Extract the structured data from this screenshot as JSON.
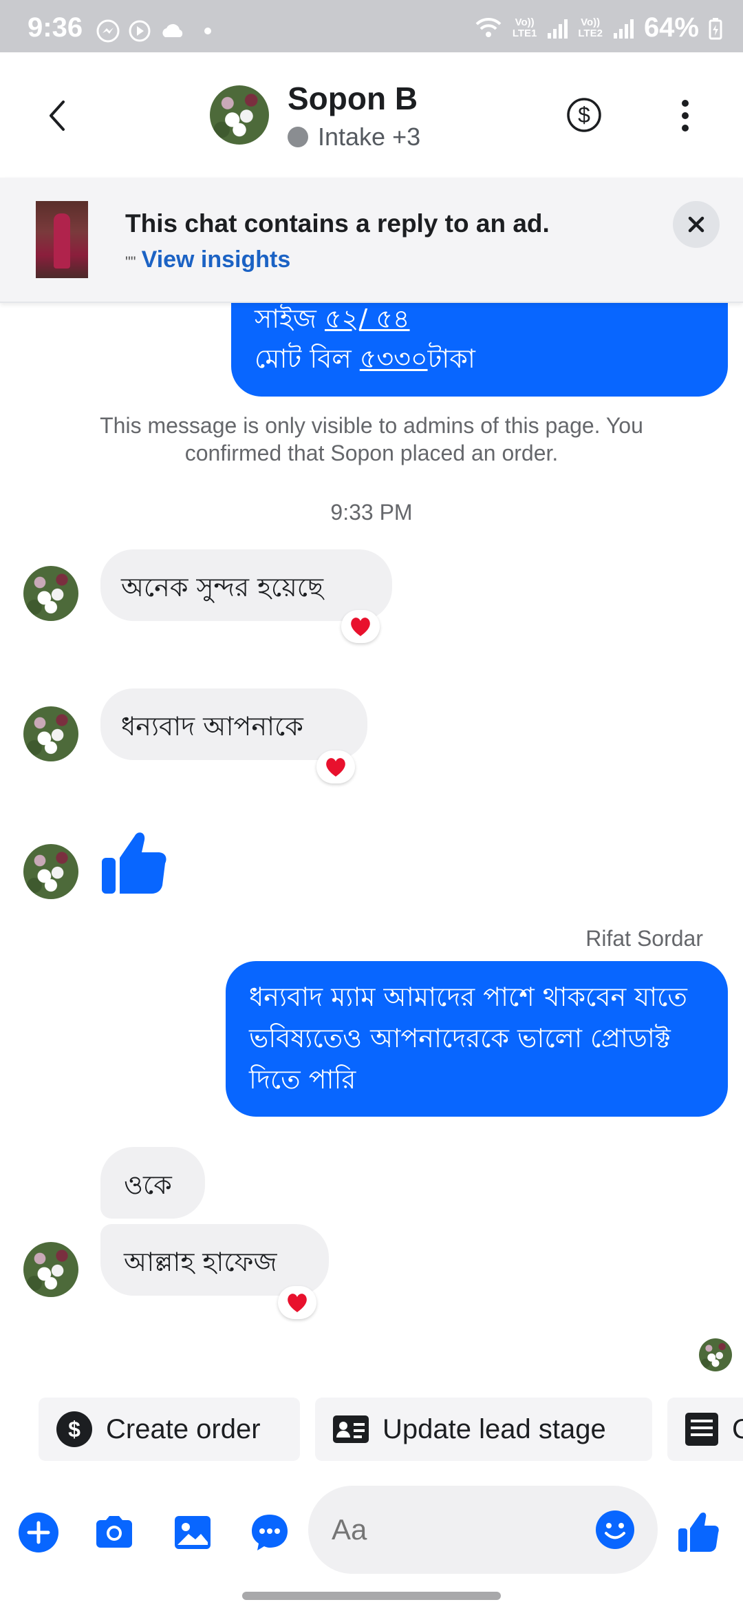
{
  "status_bar": {
    "time": "9:36",
    "sim1": "Vo))\nLTE1",
    "sim2": "Vo))\nLTE2",
    "battery": "64%"
  },
  "header": {
    "contact_name": "Sopon B",
    "subtitle": "Intake +3",
    "icons": [
      "back-arrow-icon",
      "dollar-icon",
      "more-vertical-icon"
    ]
  },
  "ad_banner": {
    "title": "This chat contains a reply to an ad.",
    "quote_mark": "\"\"",
    "link": "View insights"
  },
  "messages": {
    "top_line1_prefix": "সাইজ ",
    "top_line1_value": "৫২/ ৫৪",
    "top_line2_prefix": "মোট বিল ",
    "top_line2_value": "৫৩৩০",
    "top_line2_suffix": "টাকা",
    "admin_note": "This message is only visible to admins of this page. You confirmed that Sopon placed an order.",
    "time_separator": "9:33 PM",
    "msg1": "অনেক সুন্দর হয়েছে",
    "msg2": "ধন্যবাদ আপনাকে",
    "sender_name": "Rifat Sordar",
    "msg3": "ধন্যবাদ ম্যাম আমাদের পাশে থাকবেন যাতে ভবিষ্যতেও আপনাদেরকে ভালো প্রোডাক্ট দিতে পারি",
    "msg4": "ওকে",
    "msg5": "আল্লাহ হাফেজ",
    "reaction": "❤"
  },
  "quick_actions": {
    "create_order": "Create order",
    "update_lead": "Update lead stage",
    "third_partial": "C"
  },
  "composer": {
    "placeholder": "Aa"
  },
  "colors": {
    "messenger_blue": "#0866ff",
    "incoming_bubble": "#f0f0f2",
    "link_blue": "#1b62c4",
    "heart_red": "#e8112d"
  }
}
